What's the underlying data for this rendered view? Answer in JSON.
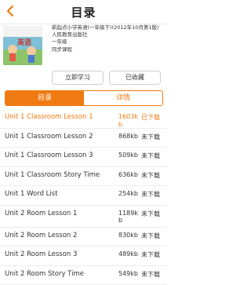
{
  "header": {
    "title": "目录"
  },
  "book": {
    "name": "新起点小学英语(一年级下)(2012年10月第1版)",
    "publisher": "人民教育出版社",
    "grade": "一年级",
    "type": "同步课程",
    "cover_text": "英语"
  },
  "actions": {
    "study_label": "立即学习",
    "fav_label": "已收藏"
  },
  "tabs": {
    "toc": "目录",
    "detail": "详情"
  },
  "lessons": [
    {
      "name": "Unit 1 Classroom Lesson 1",
      "size": "1603kb",
      "status": "已下载"
    },
    {
      "name": "Unit 1 Classroom Lesson 2",
      "size": "868kb",
      "status": "未下载"
    },
    {
      "name": "Unit 1 Classroom Lesson 3",
      "size": "509kb",
      "status": "未下载"
    },
    {
      "name": "Unit 1 Classroom Story Time",
      "size": "636kb",
      "status": "未下载"
    },
    {
      "name": "Unit 1 Word List",
      "size": "254kb",
      "status": "未下载"
    },
    {
      "name": "Unit 2 Room Lesson 1",
      "size": "1189kb",
      "status": "未下载"
    },
    {
      "name": "Unit 2 Room Lesson 2",
      "size": "830kb",
      "status": "未下载"
    },
    {
      "name": "Unit 2 Room Lesson 3",
      "size": "489kb",
      "status": "未下载"
    },
    {
      "name": "Unit 2 Room Story Time",
      "size": "549kb",
      "status": "未下载"
    }
  ],
  "colors": {
    "accent": "#f07a12"
  }
}
